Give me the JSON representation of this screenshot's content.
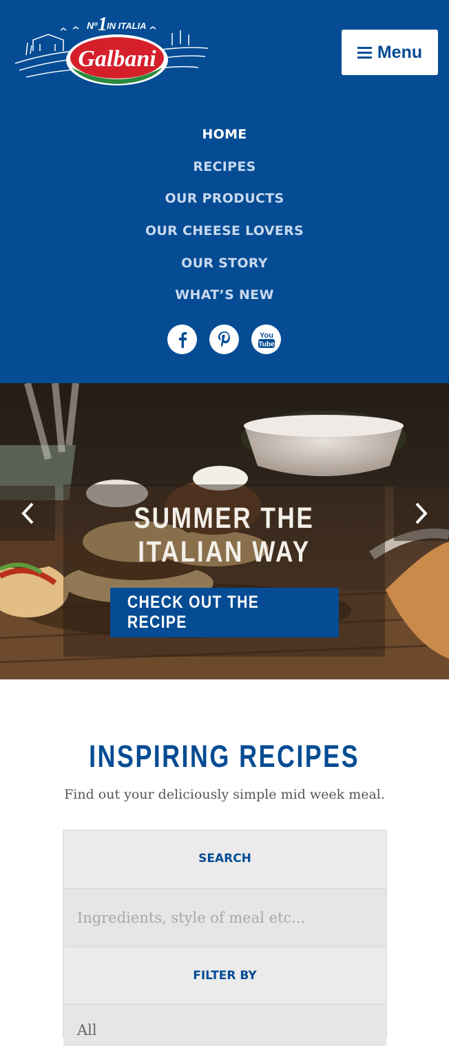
{
  "brand": {
    "logo_tagline": "Nº1 IN ITALIA",
    "logo_name": "Galbani"
  },
  "header": {
    "menu_label": "Menu",
    "nav": [
      {
        "label": "HOME"
      },
      {
        "label": "RECIPES"
      },
      {
        "label": "OUR PRODUCTS"
      },
      {
        "label": "OUR CHEESE LOVERS"
      },
      {
        "label": "OUR STORY"
      },
      {
        "label": "WHAT’S NEW"
      }
    ],
    "social": [
      {
        "icon": "facebook-icon"
      },
      {
        "icon": "pinterest-icon"
      },
      {
        "icon": "youtube-icon"
      }
    ]
  },
  "hero": {
    "title": "SUMMER THE ITALIAN WAY",
    "cta_label": "CHECK OUT THE RECIPE",
    "prev_icon": "chevron-left-icon",
    "next_icon": "chevron-right-icon"
  },
  "recipes": {
    "title": "INSPIRING RECIPES",
    "subtitle": "Find out your deliciously simple mid week meal.",
    "search_label": "SEARCH",
    "search_placeholder": "Ingredients, style of meal etc...",
    "filter_label": "FILTER BY",
    "filter_value": "All"
  },
  "colors": {
    "brand_blue": "#054c94",
    "logo_red": "#d51f2b",
    "logo_green": "#2a8a3e"
  }
}
